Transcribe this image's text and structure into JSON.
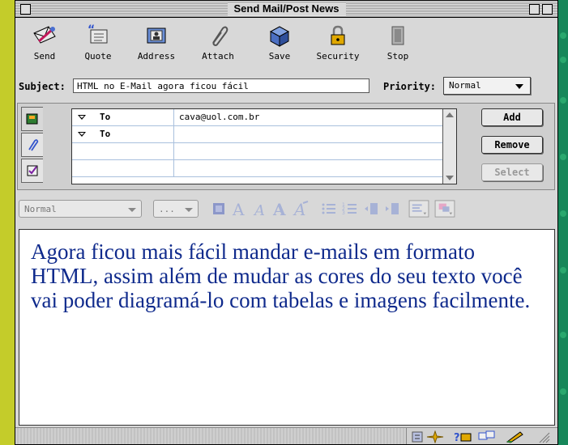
{
  "window": {
    "title": "Send Mail/Post News"
  },
  "toolbar": {
    "buttons": [
      {
        "label": "Send",
        "icon": "send-icon"
      },
      {
        "label": "Quote",
        "icon": "quote-icon"
      },
      {
        "label": "Address",
        "icon": "address-book-icon"
      },
      {
        "label": "Attach",
        "icon": "paperclip-icon"
      },
      {
        "label": "Save",
        "icon": "save-icon"
      },
      {
        "label": "Security",
        "icon": "lock-icon"
      },
      {
        "label": "Stop",
        "icon": "stop-icon"
      }
    ]
  },
  "subject": {
    "label": "Subject:",
    "value": "HTML no E-Mail agora ficou fácil"
  },
  "priority": {
    "label": "Priority:",
    "value": "Normal"
  },
  "addressing": {
    "tabs": [
      "address-tab-icon",
      "attachments-tab-icon",
      "options-tab-icon"
    ],
    "rows": [
      {
        "type": "To",
        "email": "cava@uol.com.br"
      },
      {
        "type": "To",
        "email": ""
      }
    ],
    "buttons": {
      "add": "Add",
      "remove": "Remove",
      "select": "Select"
    }
  },
  "format": {
    "paragraph_style": "Normal",
    "font_size": "..."
  },
  "body": {
    "text": "Agora ficou mais fácil mandar e-mails em formato HTML, assim além de mudar as cores do seu texto você vai poder diagramá-lo com tabelas e imagens facilmente.",
    "color": "#0f2a8c"
  },
  "colors": {
    "desktop": "#c4cc2a",
    "accent_green": "#17875a",
    "body_text": "#0f2a8c"
  }
}
